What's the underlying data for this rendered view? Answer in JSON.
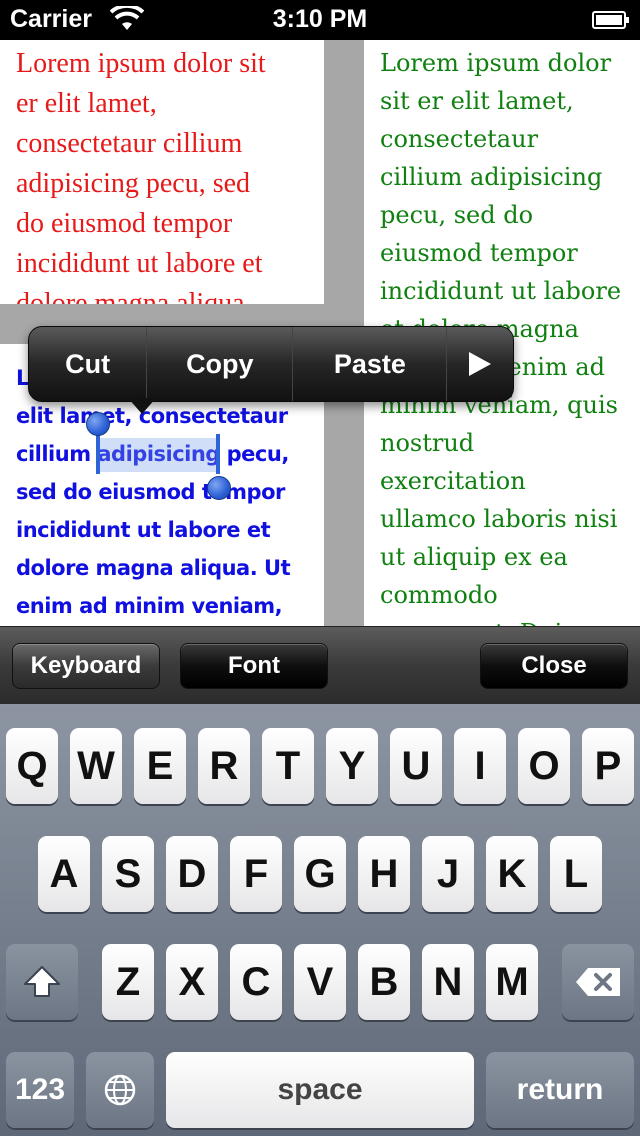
{
  "status_bar": {
    "carrier": "Carrier",
    "time": "3:10 PM"
  },
  "panes": {
    "red": "Lorem ipsum dolor sit\ner elit lamet,\nconsectetaur cillium\nadipisicing pecu, sed\ndo eiusmod tempor\nincididunt ut labore et\ndolore magna aliqua.",
    "green": "Lorem ipsum dolor\nsit er elit lamet,\nconsectetaur\ncillium adipisicing\npecu, sed do\neiusmod tempor\nincididunt ut labore\net dolore magna\naliqua. Ut enim ad\nminim veniam, quis\nnostrud\nexercitation\nullamco laboris nisi\nut aliquip ex ea\ncommodo\nconsequat. Duis",
    "blue": "Lorem ipsum dolor sit er\nelit lamet, consectetaur\ncillium adipisicing pecu,\nsed do eiusmod tempor\nincididunt ut labore et\ndolore magna aliqua. Ut\nenim ad minim veniam,"
  },
  "colors": {
    "red_text": "#e61a1a",
    "green_text": "#108010",
    "blue_text": "#1010e0",
    "selection": "#2e63d8"
  },
  "edit_menu": {
    "cut": "Cut",
    "copy": "Copy",
    "paste": "Paste",
    "more_icon": "play-right-triangle"
  },
  "toolbar": {
    "keyboard": "Keyboard",
    "font": "Font",
    "close": "Close"
  },
  "keyboard": {
    "row1": [
      "Q",
      "W",
      "E",
      "R",
      "T",
      "Y",
      "U",
      "I",
      "O",
      "P"
    ],
    "row2": [
      "A",
      "S",
      "D",
      "F",
      "G",
      "H",
      "J",
      "K",
      "L"
    ],
    "row3": [
      "Z",
      "X",
      "C",
      "V",
      "B",
      "N",
      "M"
    ],
    "numbers": "123",
    "space": "space",
    "return": "return",
    "icons": {
      "shift": "shift-arrow",
      "delete": "backspace",
      "globe": "globe"
    }
  }
}
